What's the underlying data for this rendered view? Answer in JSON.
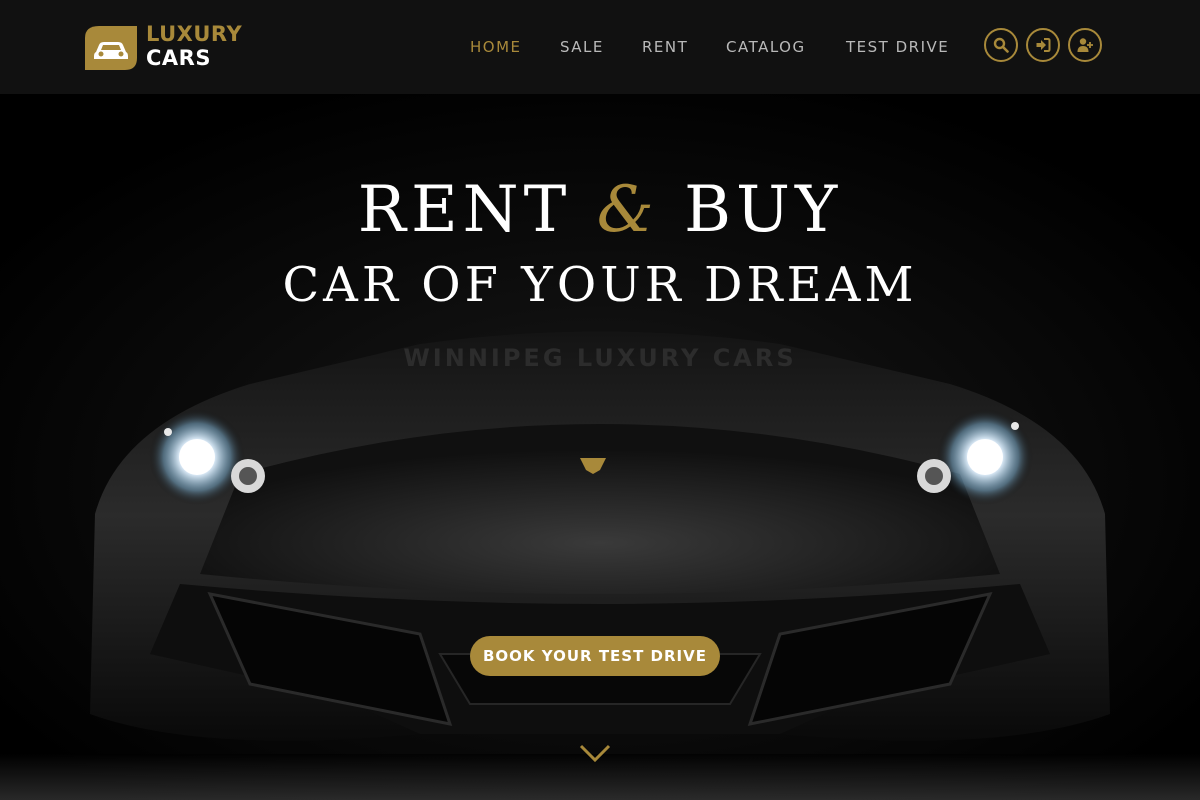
{
  "brand": {
    "line1": "LUXURY",
    "line2": "CARS"
  },
  "nav": {
    "items": [
      {
        "label": "HOME",
        "active": true
      },
      {
        "label": "SALE",
        "active": false
      },
      {
        "label": "RENT",
        "active": false
      },
      {
        "label": "CATALOG",
        "active": false
      },
      {
        "label": "TEST DRIVE",
        "active": false
      }
    ]
  },
  "header_icons": [
    "search-icon",
    "sign-in-icon",
    "user-plus-icon"
  ],
  "hero": {
    "title_part1": "RENT",
    "title_amp": "&",
    "title_part2": "BUY",
    "subtitle": "CAR OF YOUR DREAM",
    "tagline": "WINNIPEG LUXURY CARS",
    "cta_label": "BOOK YOUR TEST DRIVE"
  },
  "colors": {
    "accent": "#a8893a",
    "header_bg": "#111111",
    "page_bg": "#000000",
    "nav_text": "#b9b9b9"
  }
}
